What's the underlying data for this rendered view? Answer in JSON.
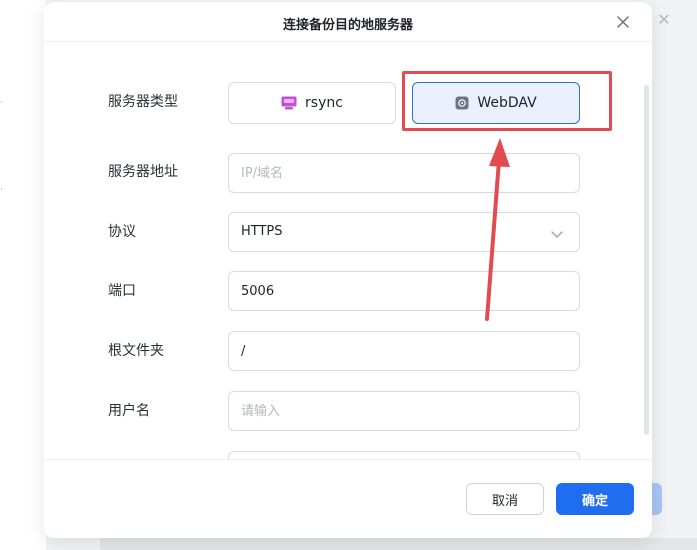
{
  "dialog": {
    "title": "连接备份目的地服务器",
    "fields": {
      "server_type": {
        "label": "服务器类型",
        "options": [
          {
            "label": "rsync",
            "icon": "rsync-icon",
            "selected": false
          },
          {
            "label": "WebDAV",
            "icon": "webdav-icon",
            "selected": true
          }
        ]
      },
      "server_address": {
        "label": "服务器地址",
        "value": "",
        "placeholder": "IP/域名"
      },
      "protocol": {
        "label": "协议",
        "value": "HTTPS"
      },
      "port": {
        "label": "端口",
        "value": "5006"
      },
      "root_folder": {
        "label": "根文件夹",
        "value": "/"
      },
      "username": {
        "label": "用户名",
        "value": "",
        "placeholder": "请输入"
      }
    },
    "buttons": {
      "cancel": "取消",
      "confirm": "确定"
    }
  },
  "colors": {
    "accent": "#1f6ef0",
    "annotation": "#e34b50",
    "selected_bg": "#eaf1fd"
  }
}
